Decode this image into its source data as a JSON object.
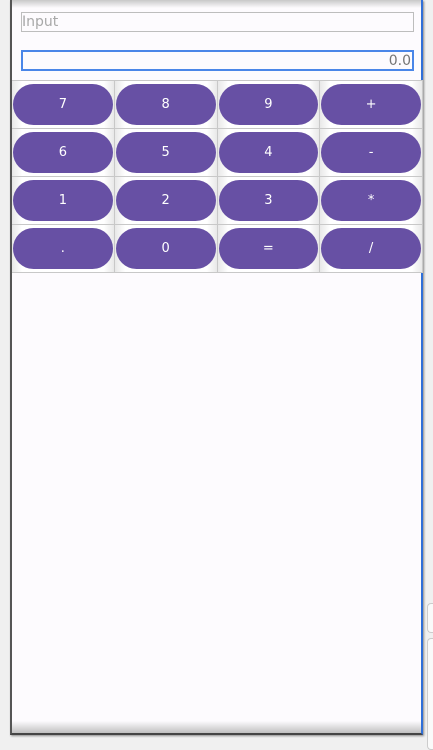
{
  "input": {
    "placeholder": "Input",
    "value": ""
  },
  "result": {
    "placeholder": "0.0",
    "value": ""
  },
  "keypad": [
    [
      "7",
      "8",
      "9",
      "+"
    ],
    [
      "6",
      "5",
      "4",
      "-"
    ],
    [
      "1",
      "2",
      "3",
      "*"
    ],
    [
      ".",
      "0",
      "=",
      "/"
    ]
  ],
  "colors": {
    "button": "#6750a4",
    "focus": "#4a86e8"
  }
}
